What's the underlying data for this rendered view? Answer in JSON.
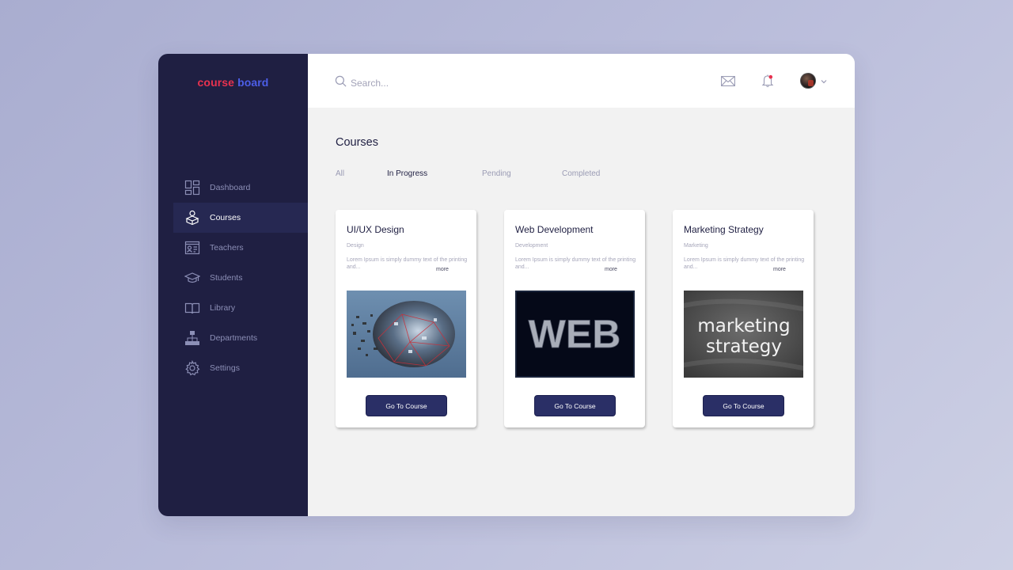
{
  "app": {
    "logo": {
      "part1": "course",
      "part2": "board",
      "color1": "#e8324f",
      "color2": "#4c5ee8"
    }
  },
  "sidebar": {
    "items": [
      {
        "label": "Dashboard",
        "icon": "dashboard-icon",
        "active": false
      },
      {
        "label": "Courses",
        "icon": "courses-icon",
        "active": true
      },
      {
        "label": "Teachers",
        "icon": "teachers-icon",
        "active": false
      },
      {
        "label": "Students",
        "icon": "students-icon",
        "active": false
      },
      {
        "label": "Library",
        "icon": "library-icon",
        "active": false
      },
      {
        "label": "Departments",
        "icon": "departments-icon",
        "active": false
      },
      {
        "label": "Settings",
        "icon": "settings-icon",
        "active": false
      }
    ]
  },
  "header": {
    "search": {
      "placeholder": "Search..."
    },
    "icons": [
      "search-icon",
      "mail-icon",
      "bell-icon",
      "chevron-down-icon"
    ]
  },
  "main": {
    "title": "Courses",
    "tabs": [
      {
        "label": "All",
        "active": false
      },
      {
        "label": "In Progress",
        "active": true
      },
      {
        "label": "Pending",
        "active": false
      },
      {
        "label": "Completed",
        "active": false
      }
    ],
    "cards": [
      {
        "title": "UI/UX Design",
        "category": "Design",
        "description": "Lorem Ipsum is simply dummy text of the printing and...",
        "more": "more",
        "button": "Go To Course"
      },
      {
        "title": "Web Development",
        "category": "Development",
        "description": "Lorem Ipsum is simply dummy text of the printing and...",
        "more": "more",
        "button": "Go To Course",
        "image_text": "WEB"
      },
      {
        "title": "Marketing Strategy",
        "category": "Marketing",
        "description": "Lorem Ipsum is simply dummy text of the printing and...",
        "more": "more",
        "button": "Go To Course",
        "image_text_1": "marketing",
        "image_text_2": "strategy"
      }
    ]
  },
  "colors": {
    "sidebar_bg": "#1f1f42",
    "button_bg": "#2a2f66",
    "content_bg": "#f2f2f2",
    "notification_dot": "#e8324f"
  }
}
